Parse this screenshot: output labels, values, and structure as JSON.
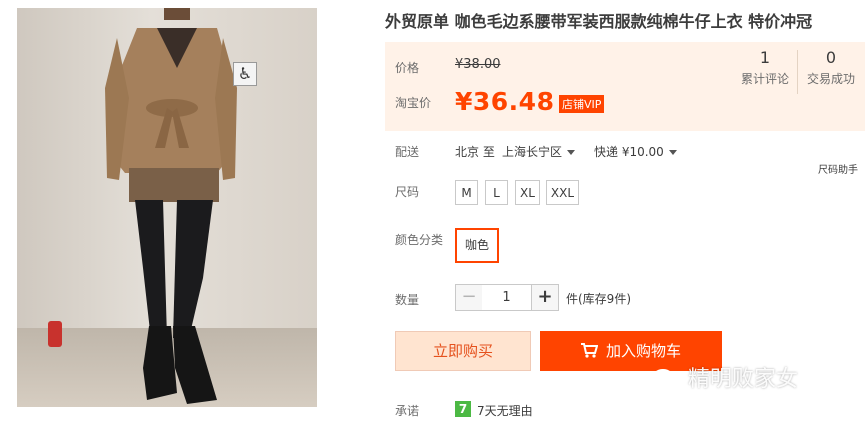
{
  "product": {
    "title": "外贸原单 咖色毛边系腰带军装西服款纯棉牛仔上衣 特价冲冠"
  },
  "price": {
    "label": "价格",
    "original": "¥38.00",
    "taobao_label": "淘宝价",
    "current": "¥36.48",
    "vip_badge": "店铺VIP"
  },
  "stats": {
    "reviews_count": "1",
    "reviews_label": "累计评论",
    "trades_count": "0",
    "trades_label": "交易成功"
  },
  "shipping": {
    "label": "配送",
    "route": "北京 至",
    "destination": "上海长宁区",
    "method": "快递 ¥10.00"
  },
  "size": {
    "label": "尺码",
    "help": "尺码助手",
    "options": [
      "M",
      "L",
      "XL",
      "XXL"
    ]
  },
  "color": {
    "label": "颜色分类",
    "selected": "咖色"
  },
  "quantity": {
    "label": "数量",
    "value": "1",
    "minus": "−",
    "plus": "+",
    "stock": "件(库存9件)"
  },
  "actions": {
    "buy_now": "立即购买",
    "add_to_cart": "加入购物车"
  },
  "promise": {
    "label": "承诺",
    "badge": "7",
    "text": "7天无理由"
  },
  "watermark": {
    "text": "精明败家女"
  },
  "colors": {
    "accent": "#ff4400",
    "price_box_bg": "#fff2e8",
    "buy_now_bg": "#ffe4d0",
    "promise_green": "#4cb944"
  }
}
